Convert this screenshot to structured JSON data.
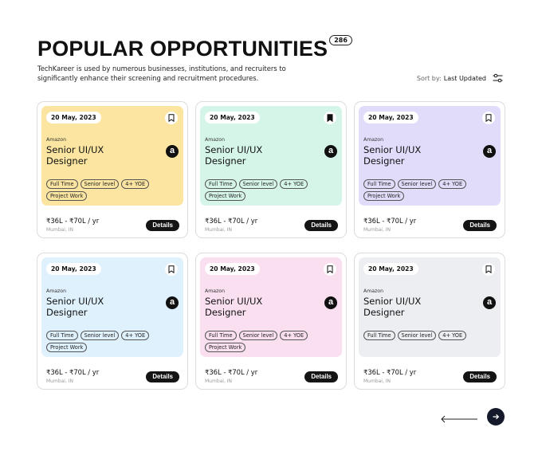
{
  "header": {
    "title": "POPULAR OPPORTUNITIES",
    "count": "286",
    "subtitle": "TechKareer is used by numerous businesses, institutions, and recruiters to significantly enhance their screening and recruitment procedures."
  },
  "sort": {
    "label": "Sort by:",
    "value": "Last Updated",
    "icon": "sliders-icon"
  },
  "cards": [
    {
      "date": "20 May, 2023",
      "bookmarked": false,
      "company": "Amazon",
      "role": "Senior UI/UX Designer",
      "logo": "a",
      "tags": [
        "Full Time",
        "Senior level",
        "4+ YOE",
        "Project Work"
      ],
      "salary": "₹36L - ₹70L / yr",
      "location": "Mumbai, IN",
      "button": "Details",
      "color": "#fbe5a0"
    },
    {
      "date": "20 May, 2023",
      "bookmarked": true,
      "company": "Amazon",
      "role": "Senior UI/UX Designer",
      "logo": "a",
      "tags": [
        "Full Time",
        "Senior level",
        "4+ YOE",
        "Project Work"
      ],
      "salary": "₹36L - ₹70L / yr",
      "location": "Mumbai, IN",
      "button": "Details",
      "color": "#d5f5e9"
    },
    {
      "date": "20 May, 2023",
      "bookmarked": false,
      "company": "Amazon",
      "role": "Senior UI/UX Designer",
      "logo": "a",
      "tags": [
        "Full Time",
        "Senior level",
        "4+ YOE",
        "Project Work"
      ],
      "salary": "₹36L - ₹70L / yr",
      "location": "Mumbai, IN",
      "button": "Details",
      "color": "#e2dcfb"
    },
    {
      "date": "20 May, 2023",
      "bookmarked": false,
      "company": "Amazon",
      "role": "Senior UI/UX Designer",
      "logo": "a",
      "tags": [
        "Full Time",
        "Senior level",
        "4+ YOE",
        "Project Work"
      ],
      "salary": "₹36L - ₹70L / yr",
      "location": "Mumbai, IN",
      "button": "Details",
      "color": "#dff1fc"
    },
    {
      "date": "20 May, 2023",
      "bookmarked": false,
      "company": "Amazon",
      "role": "Senior UI/UX Designer",
      "logo": "a",
      "tags": [
        "Full Time",
        "Senior level",
        "4+ YOE",
        "Project Work"
      ],
      "salary": "₹36L - ₹70L / yr",
      "location": "Mumbai, IN",
      "button": "Details",
      "color": "#f9dff0"
    },
    {
      "date": "20 May, 2023",
      "bookmarked": false,
      "company": "Amazon",
      "role": "Senior UI/UX Designer",
      "logo": "a",
      "tags": [
        "Full Time",
        "Senior level",
        "4+ YOE"
      ],
      "salary": "₹36L - ₹70L / yr",
      "location": "Mumbai, IN",
      "button": "Details",
      "color": "#eceef2"
    }
  ],
  "pagination": {
    "prev_icon": "arrow-left-icon",
    "next_icon": "arrow-right-icon"
  }
}
